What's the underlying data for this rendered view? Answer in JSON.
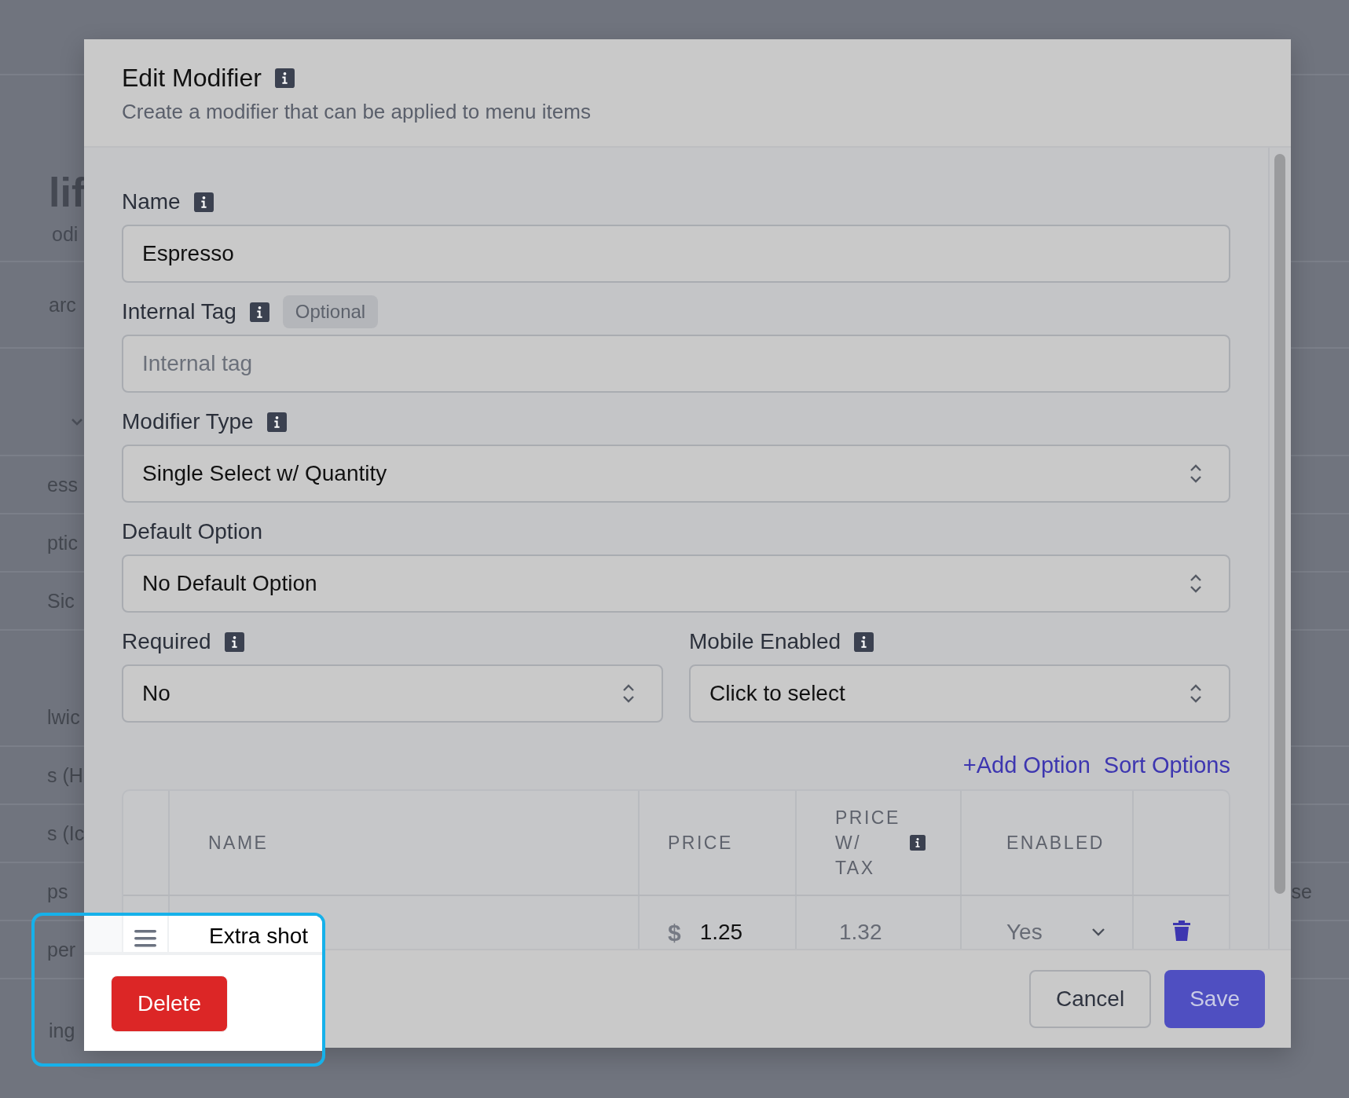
{
  "background_page": {
    "heading": "lif",
    "subheading": "odi",
    "search_placeholder": "arc",
    "rows": [
      {
        "text": "ess"
      },
      {
        "text": "ptic"
      },
      {
        "text": "Sic"
      },
      {
        "text": "lwic"
      },
      {
        "text": "s (H"
      },
      {
        "text": "s (Ic"
      },
      {
        "text": "ps",
        "right_text": "se"
      },
      {
        "text": "per"
      }
    ],
    "footer": "ing"
  },
  "modal": {
    "title": "Edit Modifier",
    "title_info": true,
    "subtitle": "Create a modifier that can be applied to menu items",
    "fields": [
      {
        "kind": "text",
        "label": "Name",
        "info": true,
        "value": "Espresso"
      },
      {
        "kind": "text",
        "label": "Internal Tag",
        "info": true,
        "badge": "Optional",
        "placeholder": "Internal tag"
      },
      {
        "kind": "select",
        "label": "Modifier Type",
        "info": true,
        "value": "Single Select w/ Quantity"
      },
      {
        "kind": "select",
        "label": "Default Option",
        "info": false,
        "value": "No Default Option"
      }
    ],
    "paired_fields": [
      {
        "kind": "select",
        "label": "Required",
        "info": true,
        "value": "No"
      },
      {
        "kind": "select",
        "label": "Mobile Enabled",
        "info": true,
        "value": "Click to select"
      }
    ],
    "links": [
      "+Add Option",
      "Sort Options"
    ],
    "options_table": {
      "columns": [
        {
          "label": "NAME",
          "info": false
        },
        {
          "label": "PRICE",
          "info": false
        },
        {
          "label": "PRICE W/ TAX",
          "info": true
        },
        {
          "label": "ENABLED",
          "info": false
        }
      ],
      "rows": [
        {
          "name": "Extra shot",
          "currency": "$",
          "price": "1.25",
          "price_with_tax": "1.32",
          "enabled": "Yes"
        }
      ]
    },
    "buttons": [
      {
        "label": "Cancel",
        "kind": "secondary"
      },
      {
        "label": "Save",
        "kind": "primary"
      }
    ]
  },
  "spotlight": {
    "button": "Delete"
  }
}
